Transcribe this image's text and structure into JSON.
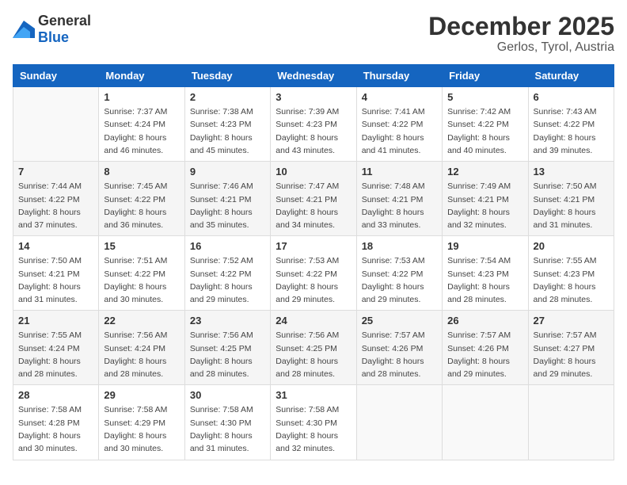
{
  "header": {
    "logo_general": "General",
    "logo_blue": "Blue",
    "month": "December 2025",
    "location": "Gerlos, Tyrol, Austria"
  },
  "days_of_week": [
    "Sunday",
    "Monday",
    "Tuesday",
    "Wednesday",
    "Thursday",
    "Friday",
    "Saturday"
  ],
  "weeks": [
    [
      {
        "day": "",
        "sunrise": "",
        "sunset": "",
        "daylight": ""
      },
      {
        "day": "1",
        "sunrise": "Sunrise: 7:37 AM",
        "sunset": "Sunset: 4:24 PM",
        "daylight": "Daylight: 8 hours and 46 minutes."
      },
      {
        "day": "2",
        "sunrise": "Sunrise: 7:38 AM",
        "sunset": "Sunset: 4:23 PM",
        "daylight": "Daylight: 8 hours and 45 minutes."
      },
      {
        "day": "3",
        "sunrise": "Sunrise: 7:39 AM",
        "sunset": "Sunset: 4:23 PM",
        "daylight": "Daylight: 8 hours and 43 minutes."
      },
      {
        "day": "4",
        "sunrise": "Sunrise: 7:41 AM",
        "sunset": "Sunset: 4:22 PM",
        "daylight": "Daylight: 8 hours and 41 minutes."
      },
      {
        "day": "5",
        "sunrise": "Sunrise: 7:42 AM",
        "sunset": "Sunset: 4:22 PM",
        "daylight": "Daylight: 8 hours and 40 minutes."
      },
      {
        "day": "6",
        "sunrise": "Sunrise: 7:43 AM",
        "sunset": "Sunset: 4:22 PM",
        "daylight": "Daylight: 8 hours and 39 minutes."
      }
    ],
    [
      {
        "day": "7",
        "sunrise": "Sunrise: 7:44 AM",
        "sunset": "Sunset: 4:22 PM",
        "daylight": "Daylight: 8 hours and 37 minutes."
      },
      {
        "day": "8",
        "sunrise": "Sunrise: 7:45 AM",
        "sunset": "Sunset: 4:22 PM",
        "daylight": "Daylight: 8 hours and 36 minutes."
      },
      {
        "day": "9",
        "sunrise": "Sunrise: 7:46 AM",
        "sunset": "Sunset: 4:21 PM",
        "daylight": "Daylight: 8 hours and 35 minutes."
      },
      {
        "day": "10",
        "sunrise": "Sunrise: 7:47 AM",
        "sunset": "Sunset: 4:21 PM",
        "daylight": "Daylight: 8 hours and 34 minutes."
      },
      {
        "day": "11",
        "sunrise": "Sunrise: 7:48 AM",
        "sunset": "Sunset: 4:21 PM",
        "daylight": "Daylight: 8 hours and 33 minutes."
      },
      {
        "day": "12",
        "sunrise": "Sunrise: 7:49 AM",
        "sunset": "Sunset: 4:21 PM",
        "daylight": "Daylight: 8 hours and 32 minutes."
      },
      {
        "day": "13",
        "sunrise": "Sunrise: 7:50 AM",
        "sunset": "Sunset: 4:21 PM",
        "daylight": "Daylight: 8 hours and 31 minutes."
      }
    ],
    [
      {
        "day": "14",
        "sunrise": "Sunrise: 7:50 AM",
        "sunset": "Sunset: 4:21 PM",
        "daylight": "Daylight: 8 hours and 31 minutes."
      },
      {
        "day": "15",
        "sunrise": "Sunrise: 7:51 AM",
        "sunset": "Sunset: 4:22 PM",
        "daylight": "Daylight: 8 hours and 30 minutes."
      },
      {
        "day": "16",
        "sunrise": "Sunrise: 7:52 AM",
        "sunset": "Sunset: 4:22 PM",
        "daylight": "Daylight: 8 hours and 29 minutes."
      },
      {
        "day": "17",
        "sunrise": "Sunrise: 7:53 AM",
        "sunset": "Sunset: 4:22 PM",
        "daylight": "Daylight: 8 hours and 29 minutes."
      },
      {
        "day": "18",
        "sunrise": "Sunrise: 7:53 AM",
        "sunset": "Sunset: 4:22 PM",
        "daylight": "Daylight: 8 hours and 29 minutes."
      },
      {
        "day": "19",
        "sunrise": "Sunrise: 7:54 AM",
        "sunset": "Sunset: 4:23 PM",
        "daylight": "Daylight: 8 hours and 28 minutes."
      },
      {
        "day": "20",
        "sunrise": "Sunrise: 7:55 AM",
        "sunset": "Sunset: 4:23 PM",
        "daylight": "Daylight: 8 hours and 28 minutes."
      }
    ],
    [
      {
        "day": "21",
        "sunrise": "Sunrise: 7:55 AM",
        "sunset": "Sunset: 4:24 PM",
        "daylight": "Daylight: 8 hours and 28 minutes."
      },
      {
        "day": "22",
        "sunrise": "Sunrise: 7:56 AM",
        "sunset": "Sunset: 4:24 PM",
        "daylight": "Daylight: 8 hours and 28 minutes."
      },
      {
        "day": "23",
        "sunrise": "Sunrise: 7:56 AM",
        "sunset": "Sunset: 4:25 PM",
        "daylight": "Daylight: 8 hours and 28 minutes."
      },
      {
        "day": "24",
        "sunrise": "Sunrise: 7:56 AM",
        "sunset": "Sunset: 4:25 PM",
        "daylight": "Daylight: 8 hours and 28 minutes."
      },
      {
        "day": "25",
        "sunrise": "Sunrise: 7:57 AM",
        "sunset": "Sunset: 4:26 PM",
        "daylight": "Daylight: 8 hours and 28 minutes."
      },
      {
        "day": "26",
        "sunrise": "Sunrise: 7:57 AM",
        "sunset": "Sunset: 4:26 PM",
        "daylight": "Daylight: 8 hours and 29 minutes."
      },
      {
        "day": "27",
        "sunrise": "Sunrise: 7:57 AM",
        "sunset": "Sunset: 4:27 PM",
        "daylight": "Daylight: 8 hours and 29 minutes."
      }
    ],
    [
      {
        "day": "28",
        "sunrise": "Sunrise: 7:58 AM",
        "sunset": "Sunset: 4:28 PM",
        "daylight": "Daylight: 8 hours and 30 minutes."
      },
      {
        "day": "29",
        "sunrise": "Sunrise: 7:58 AM",
        "sunset": "Sunset: 4:29 PM",
        "daylight": "Daylight: 8 hours and 30 minutes."
      },
      {
        "day": "30",
        "sunrise": "Sunrise: 7:58 AM",
        "sunset": "Sunset: 4:30 PM",
        "daylight": "Daylight: 8 hours and 31 minutes."
      },
      {
        "day": "31",
        "sunrise": "Sunrise: 7:58 AM",
        "sunset": "Sunset: 4:30 PM",
        "daylight": "Daylight: 8 hours and 32 minutes."
      },
      {
        "day": "",
        "sunrise": "",
        "sunset": "",
        "daylight": ""
      },
      {
        "day": "",
        "sunrise": "",
        "sunset": "",
        "daylight": ""
      },
      {
        "day": "",
        "sunrise": "",
        "sunset": "",
        "daylight": ""
      }
    ]
  ]
}
